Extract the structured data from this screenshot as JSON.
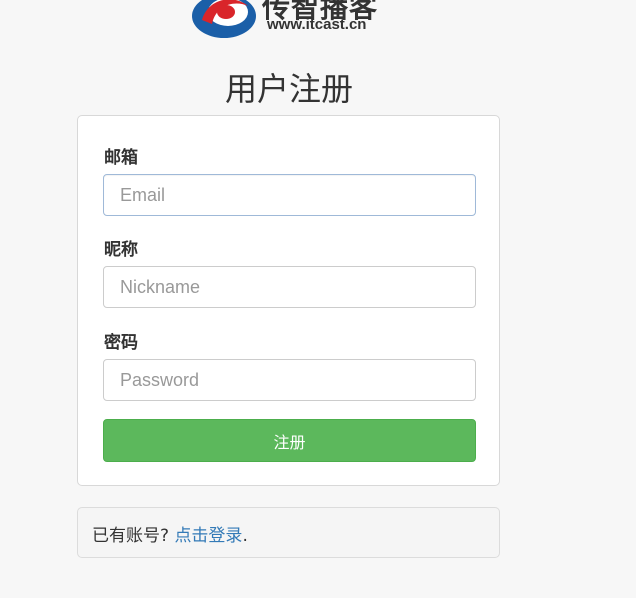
{
  "logo": {
    "name_cn": "传智播客",
    "url": "www.itcast.cn",
    "colors": {
      "red": "#d9252a",
      "blue": "#1b5fa8"
    }
  },
  "page": {
    "title": "用户注册"
  },
  "form": {
    "email": {
      "label": "邮箱",
      "placeholder": "Email",
      "value": ""
    },
    "nickname": {
      "label": "昵称",
      "placeholder": "Nickname",
      "value": ""
    },
    "password": {
      "label": "密码",
      "placeholder": "Password",
      "value": ""
    },
    "submit_label": "注册",
    "submit_color": "#5cb85c"
  },
  "footer": {
    "prefix": "已有账号?",
    "link_label": "点击登录",
    "suffix": ".",
    "link_color": "#337ab7"
  }
}
